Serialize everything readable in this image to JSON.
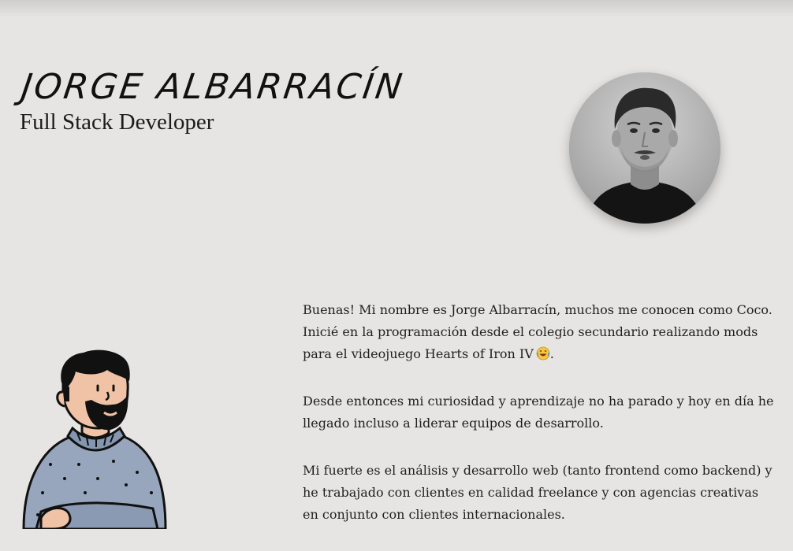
{
  "header": {
    "name": "JORGE ALBARRACÍN",
    "role": "Full Stack Developer"
  },
  "avatar": {
    "icon": "profile-photo"
  },
  "illustration": {
    "icon": "bearded-man-sweater-illustration"
  },
  "about": {
    "p1_text": "Buenas! Mi nombre es Jorge Albarracín, muchos me conocen como Coco. Inicié en la programación desde el colegio secundario realizando mods para el videojuego Hearts of Iron IV",
    "p1_end": ".",
    "p1_emoji": "laughing-crying-emoji",
    "p2": "Desde entonces mi curiosidad y aprendizaje no ha parado y hoy en día he llegado incluso a liderar equipos de desarrollo.",
    "p3": "Mi fuerte es el análisis y desarrollo web (tanto frontend como backend) y he trabajado con clientes en calidad freelance y con agencias creativas en conjunto con clientes internacionales."
  },
  "colors": {
    "background": "#e7e5e3",
    "text": "#1f1f1f",
    "sweater": "#98a6bd"
  }
}
